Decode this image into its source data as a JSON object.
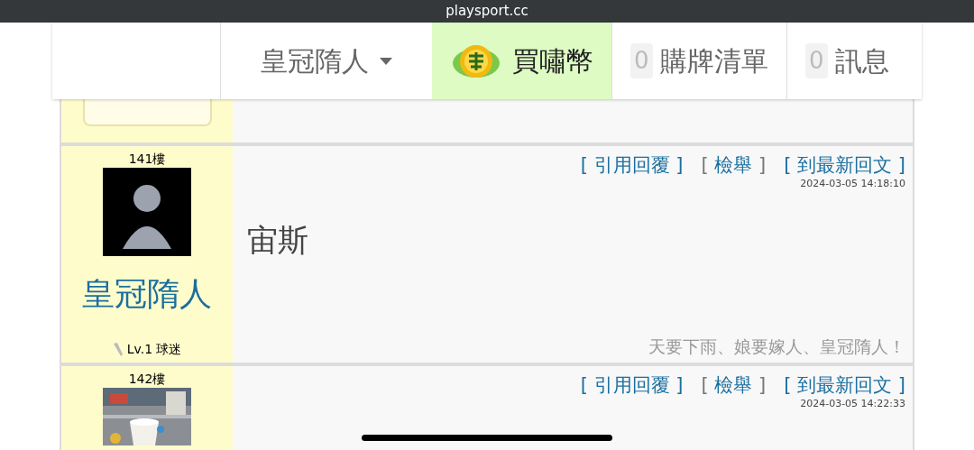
{
  "status_bar": {
    "url": "playsport.cc"
  },
  "nav": {
    "user_menu": {
      "label": "皇冠隋人"
    },
    "buy": {
      "label": "買嘯幣",
      "selected": true
    },
    "items": [
      {
        "count": "0",
        "label": "購牌清單"
      },
      {
        "count": "0",
        "label": "訊息"
      }
    ]
  },
  "posts": [
    {
      "floor": "141樓",
      "avatar": {
        "kind": "figure"
      },
      "username": "皇冠隋人",
      "level": "Lv.1",
      "rank": "球迷",
      "timestamp": "2024-03-05 14:18:10",
      "body": "宙斯",
      "signature": "天要下雨、娘要嫁人、皇冠隋人！",
      "actions": [
        {
          "open": "[",
          "label": "引用回覆",
          "close": "]",
          "kind": "link"
        },
        {
          "open": "[",
          "label": "檢舉",
          "close": "]",
          "kind": "report"
        },
        {
          "open": "[",
          "label": "到最新回文",
          "close": "]",
          "kind": "link"
        }
      ]
    },
    {
      "floor": "142樓",
      "timestamp": "2024-03-05 14:22:33",
      "actions": [
        {
          "open": "[",
          "label": "引用回覆",
          "close": "]",
          "kind": "link"
        },
        {
          "open": "[",
          "label": "檢舉",
          "close": "]",
          "kind": "report"
        },
        {
          "open": "[",
          "label": "到最新回文",
          "close": "]",
          "kind": "link"
        }
      ]
    }
  ]
}
